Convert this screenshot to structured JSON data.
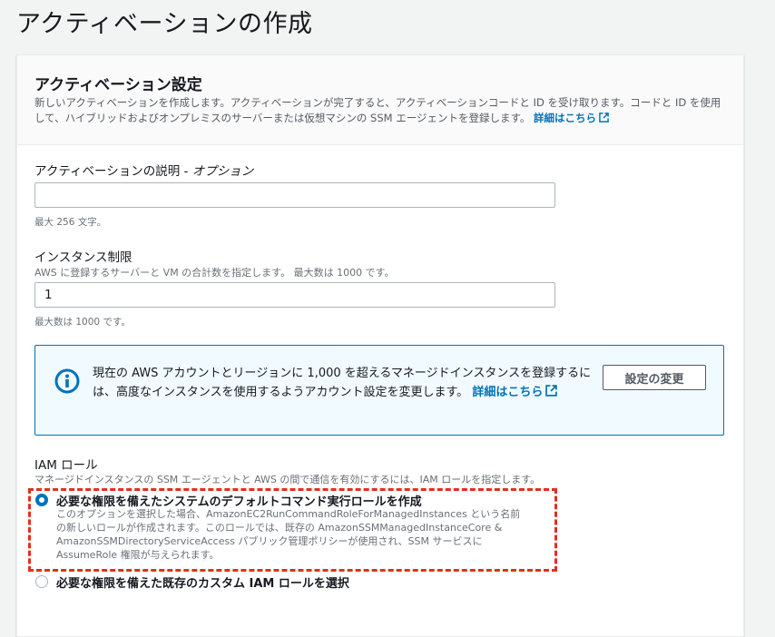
{
  "page": {
    "title": "アクティベーションの作成"
  },
  "panel": {
    "title": "アクティベーション設定",
    "description": "新しいアクティベーションを作成します。アクティベーションが完了すると、アクティベーションコードと ID を受け取ります。コードと ID を使用して、ハイブリッドおよびオンプレミスのサーバーまたは仮想マシンの SSM エージェントを登録します。",
    "learn_more_link": "詳細はこちら"
  },
  "description_field": {
    "label": "アクティベーションの説明",
    "optional": " - オプション",
    "value": "",
    "placeholder": "",
    "hint": "最大 256 文字。"
  },
  "instance_limit": {
    "label": "インスタンス制限",
    "description": "AWS に登録するサーバーと VM の合計数を指定します。 最大数は 1000 です。",
    "value": "1",
    "hint": "最大数は 1000 です。"
  },
  "info_alert": {
    "icon": "info-icon",
    "text": "現在の AWS アカウントとリージョンに 1,000 を超えるマネージドインスタンスを登録するには、高度なインスタンスを使用するようアカウント設定を変更します。",
    "link": "詳細はこちら",
    "button_label": "設定の変更"
  },
  "iam_role": {
    "label": "IAM ロール",
    "description": "マネージドインスタンスの SSM エージェントと AWS の間で通信を有効にするには、IAM ロールを指定します。",
    "options": [
      {
        "label": "必要な権限を備えたシステムのデフォルトコマンド実行ロールを作成",
        "description": "このオプションを選択した場合、AmazonEC2RunCommandRoleForManagedInstances という名前の新しいロールが作成されます。このロールでは、既存の AmazonSSMManagedInstanceCore & AmazonSSMDirectoryServiceAccess パブリック管理ポリシーが使用され、SSM サービスに AssumeRole 権限が与えられます。",
        "selected": true
      },
      {
        "label": "必要な権限を備えた既存のカスタム IAM ロールを選択",
        "selected": false
      }
    ]
  },
  "colors": {
    "accent": "#0073bb",
    "highlight": "#e0301e",
    "background": "#f2f3f3"
  }
}
